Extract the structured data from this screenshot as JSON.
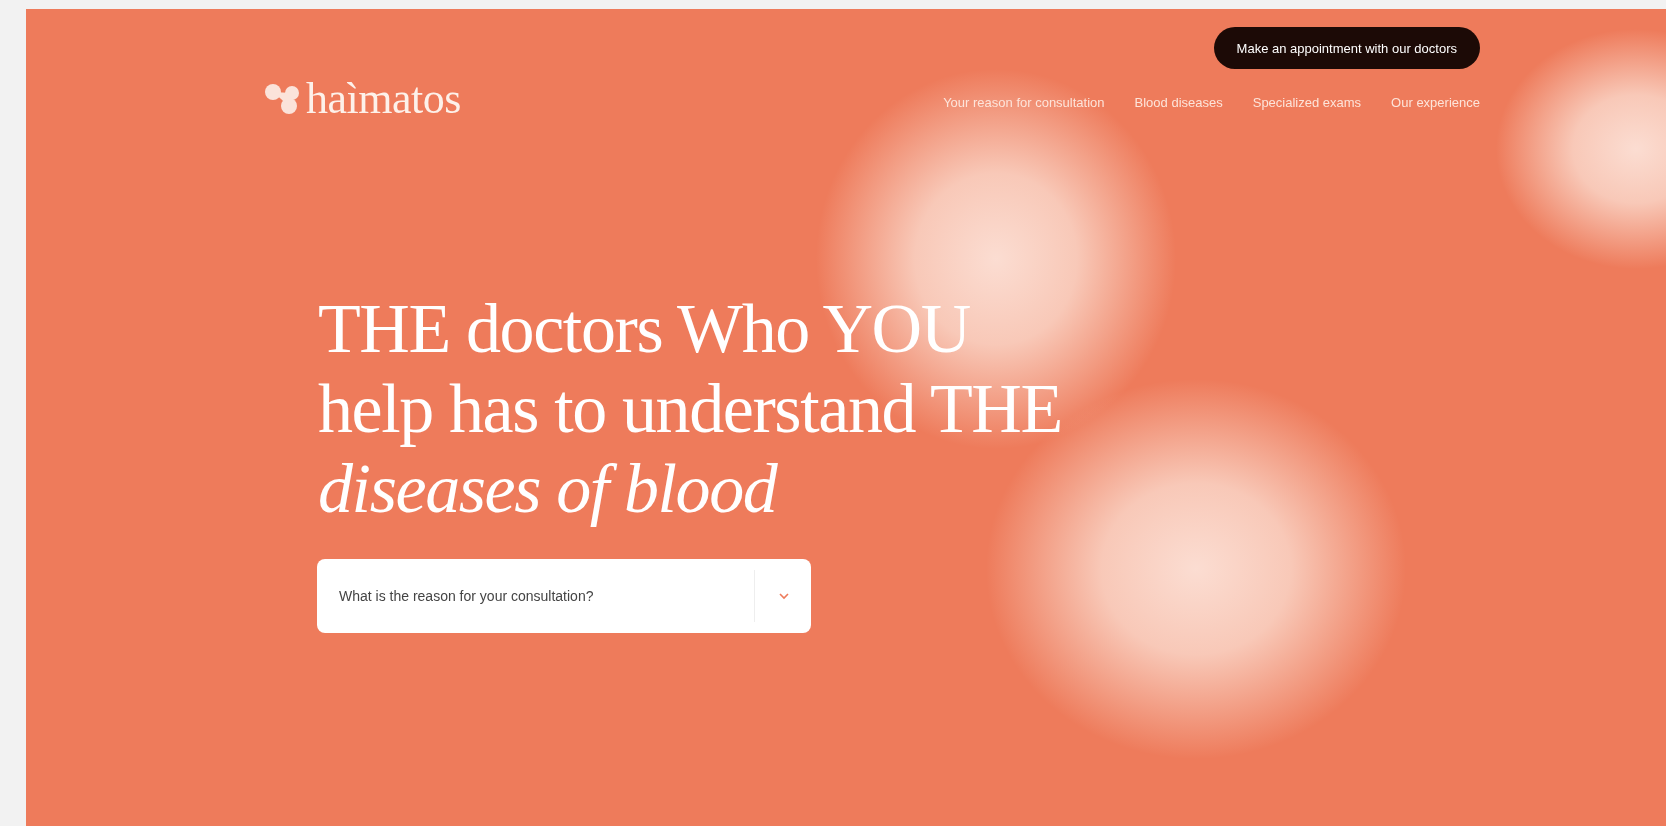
{
  "header": {
    "logo": "haìmatos",
    "cta_button": "Make an appointment with our doctors",
    "nav": [
      "Your reason for consultation",
      "Blood diseases",
      "Specialized exams",
      "Our experience"
    ]
  },
  "hero": {
    "headline_lines": [
      "THE doctors Who YOU",
      "help has to understand THE",
      "*diseases of blood*"
    ],
    "select": {
      "placeholder": "What is the reason for your consultation?"
    }
  }
}
